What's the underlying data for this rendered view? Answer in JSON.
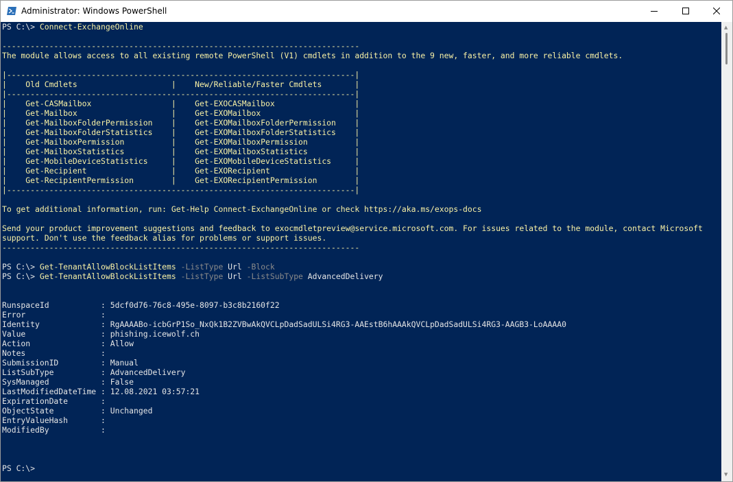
{
  "window": {
    "title": "Administrator: Windows PowerShell"
  },
  "console": {
    "prompt": "PS C:\\> ",
    "lines": [
      [
        {
          "t": "PS C:\\> ",
          "c": "white"
        },
        {
          "t": "Connect-ExchangeOnline",
          "c": "yellow"
        }
      ],
      [],
      [
        {
          "t": "----------------------------------------------------------------------------",
          "c": "yellow"
        }
      ],
      [
        {
          "t": "The module allows access to all existing remote PowerShell (V1) cmdlets in addition to the 9 new, faster, and more reliable cmdlets.",
          "c": "yellow"
        }
      ],
      [],
      [
        {
          "t": "|--------------------------------------------------------------------------|",
          "c": "yellow"
        }
      ],
      [
        {
          "t": "|    Old Cmdlets                    |    New/Reliable/Faster Cmdlets       |",
          "c": "yellow"
        }
      ],
      [
        {
          "t": "|--------------------------------------------------------------------------|",
          "c": "yellow"
        }
      ],
      [
        {
          "t": "|    Get-CASMailbox                 |    Get-EXOCASMailbox                 |",
          "c": "yellow"
        }
      ],
      [
        {
          "t": "|    Get-Mailbox                    |    Get-EXOMailbox                    |",
          "c": "yellow"
        }
      ],
      [
        {
          "t": "|    Get-MailboxFolderPermission    |    Get-EXOMailboxFolderPermission    |",
          "c": "yellow"
        }
      ],
      [
        {
          "t": "|    Get-MailboxFolderStatistics    |    Get-EXOMailboxFolderStatistics    |",
          "c": "yellow"
        }
      ],
      [
        {
          "t": "|    Get-MailboxPermission          |    Get-EXOMailboxPermission          |",
          "c": "yellow"
        }
      ],
      [
        {
          "t": "|    Get-MailboxStatistics          |    Get-EXOMailboxStatistics          |",
          "c": "yellow"
        }
      ],
      [
        {
          "t": "|    Get-MobileDeviceStatistics     |    Get-EXOMobileDeviceStatistics     |",
          "c": "yellow"
        }
      ],
      [
        {
          "t": "|    Get-Recipient                  |    Get-EXORecipient                  |",
          "c": "yellow"
        }
      ],
      [
        {
          "t": "|    Get-RecipientPermission        |    Get-EXORecipientPermission        |",
          "c": "yellow"
        }
      ],
      [
        {
          "t": "|--------------------------------------------------------------------------|",
          "c": "yellow"
        }
      ],
      [],
      [
        {
          "t": "To get additional information, run: Get-Help Connect-ExchangeOnline or check https://aka.ms/exops-docs",
          "c": "yellow"
        }
      ],
      [],
      [
        {
          "t": "Send your product improvement suggestions and feedback to exocmdletpreview@service.microsoft.com. For issues related to the module, contact Microsoft",
          "c": "yellow"
        }
      ],
      [
        {
          "t": "support. Don't use the feedback alias for problems or support issues.",
          "c": "yellow"
        }
      ],
      [
        {
          "t": "----------------------------------------------------------------------------",
          "c": "yellow"
        }
      ],
      [],
      [
        {
          "t": "PS C:\\> ",
          "c": "white"
        },
        {
          "t": "Get-TenantAllowBlockListItems",
          "c": "yellow"
        },
        {
          "t": " -ListType",
          "c": "gray"
        },
        {
          "t": " Url",
          "c": "white"
        },
        {
          "t": " -Block",
          "c": "gray"
        }
      ],
      [
        {
          "t": "PS C:\\> ",
          "c": "white"
        },
        {
          "t": "Get-TenantAllowBlockListItems",
          "c": "yellow"
        },
        {
          "t": " -ListType",
          "c": "gray"
        },
        {
          "t": " Url",
          "c": "white"
        },
        {
          "t": " -ListSubType",
          "c": "gray"
        },
        {
          "t": " AdvancedDelivery",
          "c": "white"
        }
      ],
      [],
      [],
      [
        {
          "t": "RunspaceId           : 5dcf0d76-76c8-495e-8097-b3c8b2160f22",
          "c": "white"
        }
      ],
      [
        {
          "t": "Error                :",
          "c": "white"
        }
      ],
      [
        {
          "t": "Identity             : RgAAAABo-icbGrP1So_NxQk1B2ZVBwAkQVCLpDadSadULSi4RG3-AAEstB6hAAAkQVCLpDadSadULSi4RG3-AAGB3-LoAAAA0",
          "c": "white"
        }
      ],
      [
        {
          "t": "Value                : phishing.icewolf.ch",
          "c": "white"
        }
      ],
      [
        {
          "t": "Action               : Allow",
          "c": "white"
        }
      ],
      [
        {
          "t": "Notes                :",
          "c": "white"
        }
      ],
      [
        {
          "t": "SubmissionID         : Manual",
          "c": "white"
        }
      ],
      [
        {
          "t": "ListSubType          : AdvancedDelivery",
          "c": "white"
        }
      ],
      [
        {
          "t": "SysManaged           : False",
          "c": "white"
        }
      ],
      [
        {
          "t": "LastModifiedDateTime : 12.08.2021 03:57:21",
          "c": "white"
        }
      ],
      [
        {
          "t": "ExpirationDate       :",
          "c": "white"
        }
      ],
      [
        {
          "t": "ObjectState          : Unchanged",
          "c": "white"
        }
      ],
      [
        {
          "t": "EntryValueHash       :",
          "c": "white"
        }
      ],
      [
        {
          "t": "ModifiedBy           :",
          "c": "white"
        }
      ],
      [],
      [],
      [],
      [
        {
          "t": "PS C:\\>",
          "c": "white"
        }
      ]
    ]
  },
  "colors": {
    "console_bg": "#012456",
    "text_white": "#e6e6e6",
    "text_yellow": "#f9f1a5",
    "text_gray": "#8a8a8a"
  },
  "icons": {
    "app": "powershell-icon",
    "minimize": "minimize-icon",
    "maximize": "maximize-icon",
    "close": "close-icon"
  }
}
